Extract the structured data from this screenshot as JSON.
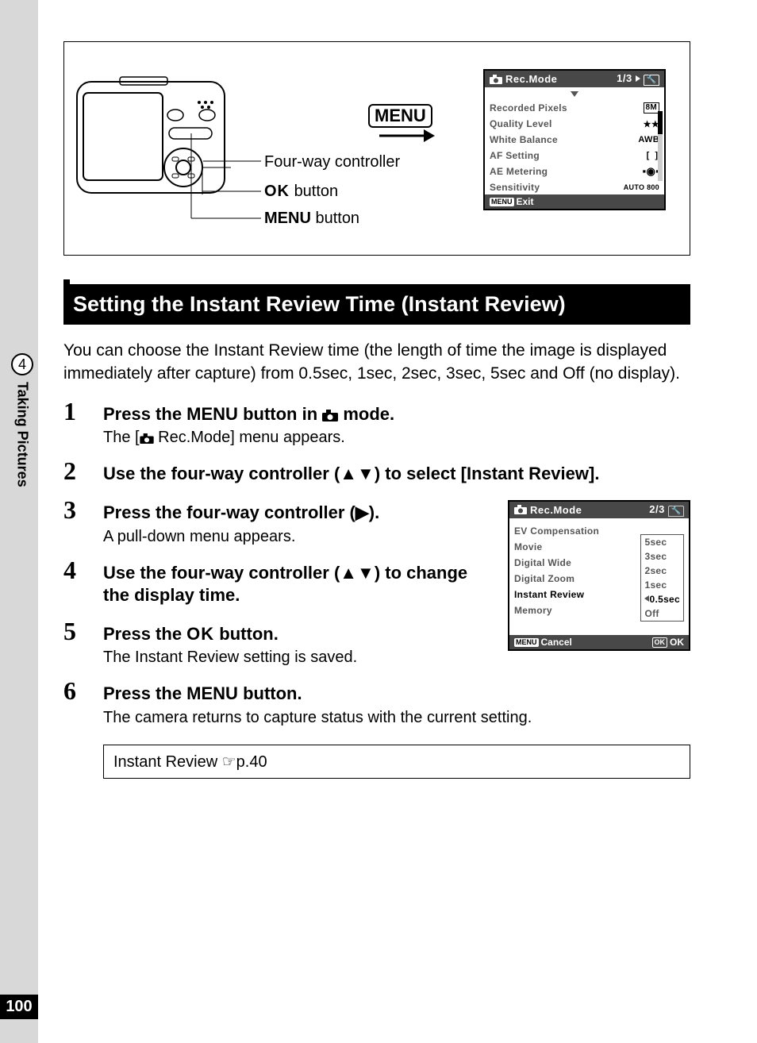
{
  "page_number": "100",
  "chapter_number": "4",
  "chapter_title": "Taking Pictures",
  "diagram": {
    "menu_label": "MENU",
    "label_fourway": "Four-way controller",
    "label_ok": "button",
    "label_ok_prefix": "OK",
    "label_menu_prefix": "MENU",
    "label_menu": "button"
  },
  "lcd1": {
    "title": "Rec.Mode",
    "page": "1/3",
    "rows": [
      {
        "label": "Recorded Pixels",
        "val": "8M"
      },
      {
        "label": "Quality Level",
        "val": "★★"
      },
      {
        "label": "White Balance",
        "val": "AWB"
      },
      {
        "label": "AF Setting",
        "val": "[ ]"
      },
      {
        "label": "AE Metering",
        "val": "◉"
      },
      {
        "label": "Sensitivity",
        "val": "AUTO 800"
      }
    ],
    "footer_left": "Exit"
  },
  "section_heading": "Setting the Instant Review Time (Instant Review)",
  "intro": "You can choose the Instant Review time (the length of time the image is displayed immediately after capture) from 0.5sec, 1sec, 2sec, 3sec, 5sec and Off (no display).",
  "steps": {
    "1": {
      "title_pre": "Press the ",
      "title_menu": "MENU",
      "title_mid": " button in ",
      "title_post": " mode.",
      "sub_pre": "The [",
      "sub_post": " Rec.Mode] menu appears."
    },
    "2": {
      "title": "Use the four-way controller (▲▼) to select [Instant Review]."
    },
    "3": {
      "title": "Press the four-way controller (▶).",
      "sub": "A pull-down menu appears."
    },
    "4": {
      "title": "Use the four-way controller (▲▼) to change the display time."
    },
    "5": {
      "title_pre": "Press the ",
      "title_ok": "OK",
      "title_post": " button.",
      "sub": "The Instant Review setting is saved."
    },
    "6": {
      "title_pre": "Press the ",
      "title_menu": "MENU",
      "title_post": " button.",
      "sub": "The camera returns to capture status with the current setting."
    }
  },
  "lcd2": {
    "title": "Rec.Mode",
    "page": "2/3",
    "rows": [
      "EV Compensation",
      "Movie",
      "Digital Wide",
      "Digital Zoom",
      "Instant Review",
      "Memory"
    ],
    "options": [
      "5sec",
      "3sec",
      "2sec",
      "1sec",
      "0.5sec",
      "Off"
    ],
    "selected": "0.5sec",
    "footer_left": "Cancel",
    "footer_right": "OK"
  },
  "ref_box": "Instant Review ☞p.40"
}
